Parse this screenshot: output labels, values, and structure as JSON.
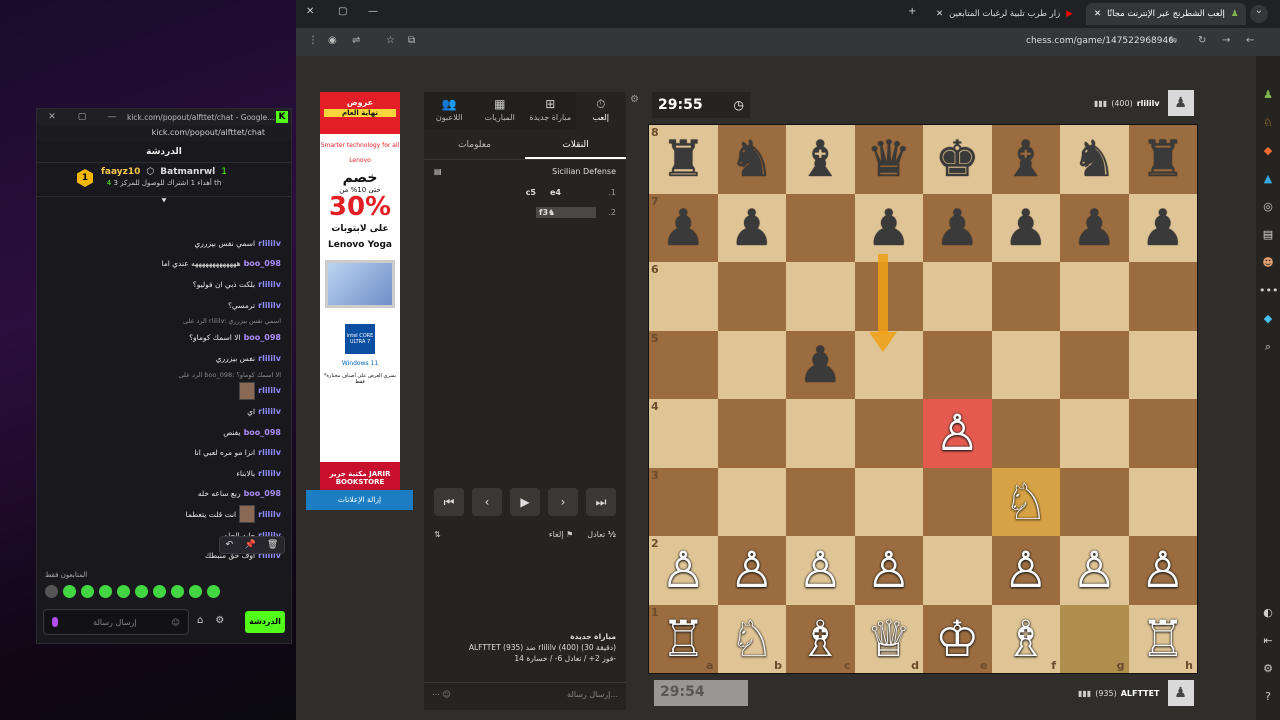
{
  "kick": {
    "window_title": "kick.com/popout/alfttet/chat - Google...",
    "url": "kick.com/popout/alfttet/chat",
    "header": "الدردشة",
    "leader": {
      "rank": "1",
      "name1": "faayz10",
      "count1": "4",
      "name2": "Batmanrwl",
      "count2": "1",
      "note": "أهداء 1 اشتراك للوصول للمركز 3 th"
    },
    "messages": [
      {
        "user": "rlililv",
        "text": "اسمي نفس بيزرري",
        "cls": "g"
      },
      {
        "user": "boo_098",
        "text": "هههههههههههههه عندي اما",
        "cls": "b"
      },
      {
        "user": "rlililv",
        "text": "بلكت ذبي ان فوليو؟",
        "cls": "g"
      },
      {
        "user": "rlililv",
        "text": "ترمسي؟",
        "cls": "g"
      },
      {
        "user": "",
        "text": "الرد على rlililv: اسمي نفس بيزرري",
        "cls": "reply"
      },
      {
        "user": "boo_098",
        "text": "الا اسمك كوماو؟",
        "cls": "b"
      },
      {
        "user": "rlililv",
        "text": "نفس بيزرري",
        "cls": "g"
      },
      {
        "user": "",
        "text": "الرد على boo_098: الا اسمك كوماو؟",
        "cls": "reply"
      },
      {
        "user": "rlililv",
        "text": "",
        "cls": "g",
        "avatar": true
      },
      {
        "user": "rlililv",
        "text": "اي",
        "cls": "g"
      },
      {
        "user": "boo_098",
        "text": "يفنص",
        "cls": "b"
      },
      {
        "user": "rlililv",
        "text": "انزا مو مره لعبي انا",
        "cls": "g"
      },
      {
        "user": "rlililv",
        "text": "بالابناء",
        "cls": "g"
      },
      {
        "user": "boo_098",
        "text": "ربع ساعه خله",
        "cls": "b"
      },
      {
        "user": "rlililv",
        "text": "انت قلت يتعطما",
        "cls": "g",
        "avatar": true
      },
      {
        "user": "rlililv",
        "text": "جايه الحلم",
        "cls": "g"
      },
      {
        "user": "rlililv",
        "text": "اوف حق منبطك",
        "cls": "g"
      }
    ],
    "emotes_label": "المتابعون فقط",
    "input_placeholder": "إرسال رسالة",
    "chat_button": "الدردشة"
  },
  "browser": {
    "tabs": [
      {
        "label": "إلعب الشطرنج عبر الإنترنت مجانًا",
        "active": true
      },
      {
        "label": "زار طرب تلبية لرغبات المتابعين",
        "active": false
      }
    ],
    "url": "chess.com/game/147522968946"
  },
  "ad": {
    "top1": "عروض",
    "top2": "نهاية العام",
    "smart": "Smarter technology for all",
    "brand": "Lenovo",
    "khasm": "خصم",
    "upto": "حتى 10% من",
    "pct": "30%",
    "line1": "على لابتوبات",
    "line2": "Lenovo Yoga",
    "intel": "intel CORE ULTRA 7",
    "win": "Windows 11",
    "note": "*بسري العرض على أصناف مختارة فقط",
    "jarir": "مكتبة جرير JARIR BOOKSTORE",
    "remove": "إزالة الإعلانات"
  },
  "panel": {
    "top_tabs": [
      {
        "label": "اللاعبون",
        "icon": "👥"
      },
      {
        "label": "المباريات",
        "icon": "▦"
      },
      {
        "label": "مباراة جديدة",
        "icon": "⊞"
      },
      {
        "label": "إلعب",
        "icon": "⏱",
        "active": true
      }
    ],
    "sub_tabs": [
      {
        "label": "معلومات",
        "active": false
      },
      {
        "label": "النقلات",
        "active": true
      }
    ],
    "opening": "Sicilian Defense",
    "moves": [
      {
        "n": "1.",
        "w": "e4",
        "b": "c5"
      },
      {
        "n": "2.",
        "w": "♞f3",
        "b": ""
      }
    ],
    "draw": "تعادل",
    "resign": "إلغاء",
    "half": "½",
    "game_title": "مباراة جديدة",
    "game_line": "ALFTTET (935) ضد rlililv (400) (30 دقيقة)",
    "game_record": "فوز 2+ / تعادل 6- / خسارة 14-",
    "chat_placeholder": "إرسال رسالة..."
  },
  "game": {
    "clock_top": "29:55",
    "clock_bottom": "29:54",
    "top_player": "rlililv",
    "top_rating": "(400)",
    "bottom_player": "ALFTTET",
    "bottom_rating": "(935)"
  },
  "board": {
    "rows": [
      [
        "♜",
        "♞",
        "♝",
        "♛",
        "♚",
        "♝",
        "♞",
        "♜"
      ],
      [
        "♟",
        "♟",
        "",
        "♟",
        "♟",
        "♟",
        "♟",
        "♟"
      ],
      [
        "",
        "",
        "",
        "",
        "",
        "",
        "",
        ""
      ],
      [
        "",
        "",
        "♟",
        "",
        "",
        "",
        "",
        ""
      ],
      [
        "",
        "",
        "",
        "",
        "♙",
        "",
        "",
        ""
      ],
      [
        "",
        "",
        "",
        "",
        "",
        "♘",
        "",
        ""
      ],
      [
        "♙",
        "♙",
        "♙",
        "♙",
        "",
        "♙",
        "♙",
        "♙"
      ],
      [
        "♖",
        "♘",
        "♗",
        "♕",
        "♔",
        "♗",
        "",
        "♖"
      ]
    ],
    "ranks": [
      "8",
      "7",
      "6",
      "5",
      "4",
      "3",
      "2",
      "1"
    ],
    "files": [
      "a",
      "b",
      "c",
      "d",
      "e",
      "f",
      "g",
      "h"
    ]
  }
}
